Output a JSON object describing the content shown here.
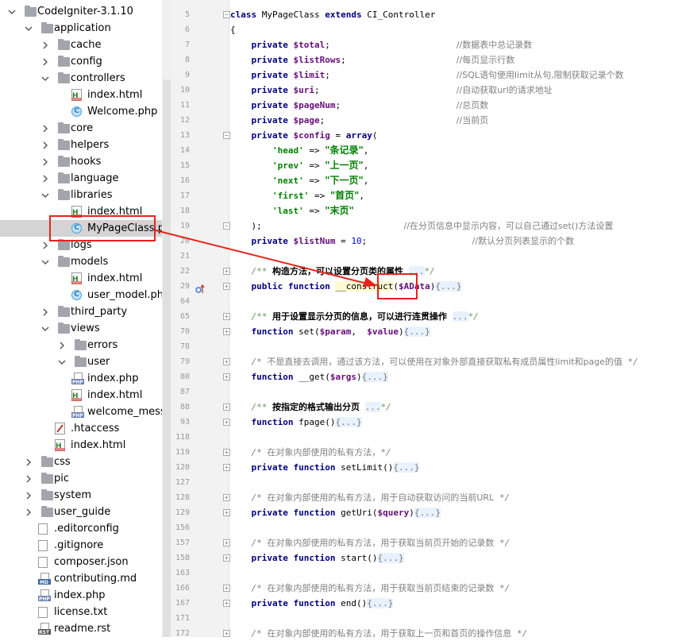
{
  "project_tree": {
    "items": [
      {
        "label": "CodeIgniter-3.1.10",
        "icon": "folder-icon",
        "depth": 0,
        "expanded": true
      },
      {
        "label": "application",
        "icon": "folder-icon",
        "depth": 1,
        "expanded": true
      },
      {
        "label": "cache",
        "icon": "folder-icon",
        "depth": 2,
        "expanded": false
      },
      {
        "label": "config",
        "icon": "folder-icon",
        "depth": 2,
        "expanded": false
      },
      {
        "label": "controllers",
        "icon": "folder-icon",
        "depth": 2,
        "expanded": true
      },
      {
        "label": "index.html",
        "icon": "html-file-icon",
        "depth": 3
      },
      {
        "label": "Welcome.php",
        "icon": "php-class-file-icon",
        "depth": 3
      },
      {
        "label": "core",
        "icon": "folder-icon",
        "depth": 2,
        "expanded": false
      },
      {
        "label": "helpers",
        "icon": "folder-icon",
        "depth": 2,
        "expanded": false
      },
      {
        "label": "hooks",
        "icon": "folder-icon",
        "depth": 2,
        "expanded": false
      },
      {
        "label": "language",
        "icon": "folder-icon",
        "depth": 2,
        "expanded": false
      },
      {
        "label": "libraries",
        "icon": "folder-icon",
        "depth": 2,
        "expanded": true
      },
      {
        "label": "index.html",
        "icon": "html-file-icon",
        "depth": 3
      },
      {
        "label": "MyPageClass.php",
        "icon": "php-class-file-icon",
        "depth": 3,
        "selected": true
      },
      {
        "label": "logs",
        "icon": "folder-icon",
        "depth": 2,
        "expanded": false
      },
      {
        "label": "models",
        "icon": "folder-icon",
        "depth": 2,
        "expanded": true
      },
      {
        "label": "index.html",
        "icon": "html-file-icon",
        "depth": 3
      },
      {
        "label": "user_model.php",
        "icon": "php-class-file-icon",
        "depth": 3
      },
      {
        "label": "third_party",
        "icon": "folder-icon",
        "depth": 2,
        "expanded": false
      },
      {
        "label": "views",
        "icon": "folder-icon",
        "depth": 2,
        "expanded": true
      },
      {
        "label": "errors",
        "icon": "folder-icon",
        "depth": 3,
        "expanded": false
      },
      {
        "label": "user",
        "icon": "folder-icon",
        "depth": 3,
        "expanded": true
      },
      {
        "label": "index.php",
        "icon": "php-file-icon",
        "depth": 4
      },
      {
        "label": "index.html",
        "icon": "html-file-icon",
        "depth": 3
      },
      {
        "label": "welcome_message.ph",
        "icon": "php-file-icon",
        "depth": 3
      },
      {
        "label": ".htaccess",
        "icon": "htaccess-file-icon",
        "depth": 2
      },
      {
        "label": "index.html",
        "icon": "html-file-icon",
        "depth": 2
      },
      {
        "label": "css",
        "icon": "folder-icon",
        "depth": 1,
        "expanded": false
      },
      {
        "label": "pic",
        "icon": "folder-icon",
        "depth": 1,
        "expanded": false
      },
      {
        "label": "system",
        "icon": "folder-icon",
        "depth": 1,
        "expanded": false
      },
      {
        "label": "user_guide",
        "icon": "folder-icon",
        "depth": 1,
        "expanded": false
      },
      {
        "label": ".editorconfig",
        "icon": "text-file-icon",
        "depth": 1
      },
      {
        "label": ".gitignore",
        "icon": "text-file-icon",
        "depth": 1
      },
      {
        "label": "composer.json",
        "icon": "text-file-icon",
        "depth": 1
      },
      {
        "label": "contributing.md",
        "icon": "md-file-icon",
        "depth": 1
      },
      {
        "label": "index.php",
        "icon": "php-file-icon",
        "depth": 1
      },
      {
        "label": "license.txt",
        "icon": "text-file-icon",
        "depth": 1
      },
      {
        "label": "readme.rst",
        "icon": "rst-file-icon",
        "depth": 1
      }
    ]
  },
  "editor": {
    "lines": [
      {
        "n": "5",
        "fold": "-",
        "tokens": [
          [
            "kw",
            "class "
          ],
          [
            "",
            "MyPageClass "
          ],
          [
            "kw",
            "extends "
          ],
          [
            "",
            "CI_Controller"
          ]
        ]
      },
      {
        "n": "6",
        "tokens": [
          [
            "",
            "{"
          ]
        ]
      },
      {
        "n": "7",
        "tokens": [
          [
            "",
            "    "
          ],
          [
            "kw",
            "private "
          ],
          [
            "var",
            "$total"
          ],
          [
            "",
            ";                        "
          ],
          [
            "cmz",
            "//数据表中总记录数"
          ]
        ]
      },
      {
        "n": "8",
        "tokens": [
          [
            "",
            "    "
          ],
          [
            "kw",
            "private "
          ],
          [
            "var",
            "$listRows"
          ],
          [
            "",
            ";                     "
          ],
          [
            "cmz",
            "//每页显示行数"
          ]
        ]
      },
      {
        "n": "9",
        "tokens": [
          [
            "",
            "    "
          ],
          [
            "kw",
            "private "
          ],
          [
            "var",
            "$limit"
          ],
          [
            "",
            ";                        "
          ],
          [
            "cmz",
            "//SQL语句使用limit从句,限制获取记录个数"
          ]
        ]
      },
      {
        "n": "10",
        "tokens": [
          [
            "",
            "    "
          ],
          [
            "kw",
            "private "
          ],
          [
            "var",
            "$uri"
          ],
          [
            "",
            ";                          "
          ],
          [
            "cmz",
            "//自动获取url的请求地址"
          ]
        ]
      },
      {
        "n": "11",
        "tokens": [
          [
            "",
            "    "
          ],
          [
            "kw",
            "private "
          ],
          [
            "var",
            "$pageNum"
          ],
          [
            "",
            ";                      "
          ],
          [
            "cmz",
            "//总页数"
          ]
        ]
      },
      {
        "n": "12",
        "tokens": [
          [
            "",
            "    "
          ],
          [
            "kw",
            "private "
          ],
          [
            "var",
            "$page"
          ],
          [
            "",
            ";                         "
          ],
          [
            "cmz",
            "//当前页"
          ]
        ]
      },
      {
        "n": "13",
        "fold": "-",
        "tokens": [
          [
            "",
            "    "
          ],
          [
            "kw",
            "private "
          ],
          [
            "var",
            "$config "
          ],
          [
            "",
            "= "
          ],
          [
            "kw",
            "array"
          ],
          [
            "",
            "("
          ]
        ]
      },
      {
        "n": "14",
        "tokens": [
          [
            "",
            "        "
          ],
          [
            "str",
            "'head'"
          ],
          [
            "",
            " => "
          ],
          [
            "cstr",
            "\"条记录\""
          ],
          [
            "",
            ","
          ]
        ]
      },
      {
        "n": "15",
        "tokens": [
          [
            "",
            "        "
          ],
          [
            "str",
            "'prev'"
          ],
          [
            "",
            " => "
          ],
          [
            "cstr",
            "\"上一页\""
          ],
          [
            "",
            ","
          ]
        ]
      },
      {
        "n": "16",
        "tokens": [
          [
            "",
            "        "
          ],
          [
            "str",
            "'next'"
          ],
          [
            "",
            " => "
          ],
          [
            "cstr",
            "\"下一页\""
          ],
          [
            "",
            ","
          ]
        ]
      },
      {
        "n": "17",
        "tokens": [
          [
            "",
            "        "
          ],
          [
            "str",
            "'first'"
          ],
          [
            "",
            " => "
          ],
          [
            "cstr",
            "\"首页\""
          ],
          [
            "",
            ","
          ]
        ]
      },
      {
        "n": "18",
        "tokens": [
          [
            "",
            "        "
          ],
          [
            "str",
            "'last'"
          ],
          [
            "",
            " => "
          ],
          [
            "cstr",
            "\"末页\""
          ]
        ]
      },
      {
        "n": "19",
        "fold": "-",
        "tokens": [
          [
            "",
            "    );                           "
          ],
          [
            "cmz",
            "//在分页信息中显示内容，可以自己通过set()方法设置"
          ]
        ]
      },
      {
        "n": "20",
        "tokens": [
          [
            "",
            "    "
          ],
          [
            "kw",
            "private "
          ],
          [
            "var",
            "$listNum "
          ],
          [
            "",
            "= "
          ],
          [
            "num",
            "10"
          ],
          [
            "",
            ";                    "
          ],
          [
            "cmz",
            "//默认分页列表显示的个数"
          ]
        ]
      },
      {
        "n": "21",
        "tokens": [
          [
            "",
            ""
          ]
        ]
      },
      {
        "n": "22",
        "fold": "+",
        "tokens": [
          [
            "",
            "    "
          ],
          [
            "doc",
            "/** "
          ],
          [
            "docz",
            "构造方法，可以设置分页类的属性"
          ],
          [
            "doc",
            " "
          ],
          [
            "dots",
            "..."
          ],
          [
            "doc",
            "*/"
          ]
        ]
      },
      {
        "n": "29",
        "fold": "+",
        "marker": true,
        "tokens": [
          [
            "",
            "    "
          ],
          [
            "kw",
            "public function "
          ],
          [
            "fn",
            "__construct"
          ],
          [
            "",
            "("
          ],
          [
            "var",
            "$AData"
          ],
          [
            "",
            ")"
          ],
          [
            "dots",
            "{...}"
          ]
        ]
      },
      {
        "n": "64",
        "tokens": [
          [
            "",
            ""
          ]
        ]
      },
      {
        "n": "65",
        "fold": "+",
        "tokens": [
          [
            "",
            "    "
          ],
          [
            "doc",
            "/** "
          ],
          [
            "docz",
            "用于设置显示分页的信息，可以进行连贯操作"
          ],
          [
            "doc",
            " "
          ],
          [
            "dots",
            "..."
          ],
          [
            "doc",
            "*/"
          ]
        ]
      },
      {
        "n": "70",
        "fold": "+",
        "tokens": [
          [
            "",
            "    "
          ],
          [
            "kw",
            "function "
          ],
          [
            "",
            "set("
          ],
          [
            "var",
            "$param"
          ],
          [
            "",
            ",  "
          ],
          [
            "var",
            "$value"
          ],
          [
            "",
            ")"
          ],
          [
            "dots",
            "{...}"
          ]
        ]
      },
      {
        "n": "78",
        "tokens": [
          [
            "",
            ""
          ]
        ]
      },
      {
        "n": "79",
        "fold": "+",
        "tokens": [
          [
            "",
            "    "
          ],
          [
            "cm",
            "/* "
          ],
          [
            "cmz",
            "不是直接去调用，通过该方法，可以使用在对象外部直接获取私有成员属性limit和page的值"
          ],
          [
            "cm",
            " */"
          ]
        ]
      },
      {
        "n": "80",
        "fold": "+",
        "tokens": [
          [
            "",
            "    "
          ],
          [
            "kw",
            "function "
          ],
          [
            "",
            "__get("
          ],
          [
            "var",
            "$args"
          ],
          [
            "",
            ")"
          ],
          [
            "dots",
            "{...}"
          ]
        ]
      },
      {
        "n": "87",
        "tokens": [
          [
            "",
            ""
          ]
        ]
      },
      {
        "n": "88",
        "fold": "+",
        "tokens": [
          [
            "",
            "    "
          ],
          [
            "doc",
            "/** "
          ],
          [
            "docz",
            "按指定的格式输出分页"
          ],
          [
            "doc",
            " "
          ],
          [
            "dots",
            "..."
          ],
          [
            "doc",
            "*/"
          ]
        ]
      },
      {
        "n": "93",
        "fold": "+",
        "tokens": [
          [
            "",
            "    "
          ],
          [
            "kw",
            "function "
          ],
          [
            "",
            "fpage()"
          ],
          [
            "dots",
            "{...}"
          ]
        ]
      },
      {
        "n": "118",
        "tokens": [
          [
            "",
            ""
          ]
        ]
      },
      {
        "n": "119",
        "fold": "+",
        "tokens": [
          [
            "",
            "    "
          ],
          [
            "cm",
            "/* "
          ],
          [
            "cmz",
            "在对象内部使用的私有方法，"
          ],
          [
            "cm",
            "*/"
          ]
        ]
      },
      {
        "n": "120",
        "fold": "+",
        "tokens": [
          [
            "",
            "    "
          ],
          [
            "kw",
            "private function "
          ],
          [
            "",
            "setLimit()"
          ],
          [
            "dots",
            "{...}"
          ]
        ]
      },
      {
        "n": "127",
        "tokens": [
          [
            "",
            ""
          ]
        ]
      },
      {
        "n": "128",
        "fold": "+",
        "tokens": [
          [
            "",
            "    "
          ],
          [
            "cm",
            "/* "
          ],
          [
            "cmz",
            "在对象内部使用的私有方法，用于自动获取访问的当前URL"
          ],
          [
            "cm",
            " */"
          ]
        ]
      },
      {
        "n": "129",
        "fold": "+",
        "tokens": [
          [
            "",
            "    "
          ],
          [
            "kw",
            "private function "
          ],
          [
            "",
            "getUri("
          ],
          [
            "var",
            "$query"
          ],
          [
            "",
            ")"
          ],
          [
            "dots",
            "{...}"
          ]
        ]
      },
      {
        "n": "156",
        "tokens": [
          [
            "",
            ""
          ]
        ]
      },
      {
        "n": "157",
        "fold": "+",
        "tokens": [
          [
            "",
            "    "
          ],
          [
            "cm",
            "/* "
          ],
          [
            "cmz",
            "在对象内部使用的私有方法，用于获取当前页开始的记录数"
          ],
          [
            "cm",
            " */"
          ]
        ]
      },
      {
        "n": "158",
        "fold": "+",
        "tokens": [
          [
            "",
            "    "
          ],
          [
            "kw",
            "private function "
          ],
          [
            "",
            "start()"
          ],
          [
            "dots",
            "{...}"
          ]
        ]
      },
      {
        "n": "163",
        "tokens": [
          [
            "",
            ""
          ]
        ]
      },
      {
        "n": "166",
        "fold": "+",
        "tokens": [
          [
            "",
            "    "
          ],
          [
            "cm",
            "/* "
          ],
          [
            "cmz",
            "在对象内部使用的私有方法，用于获取当前页结束的记录数"
          ],
          [
            "cm",
            " */"
          ]
        ]
      },
      {
        "n": "167",
        "fold": "+",
        "tokens": [
          [
            "",
            "    "
          ],
          [
            "kw",
            "private function "
          ],
          [
            "",
            "end()"
          ],
          [
            "dots",
            "{...}"
          ]
        ]
      },
      {
        "n": "171",
        "tokens": [
          [
            "",
            ""
          ]
        ]
      },
      {
        "n": "172",
        "fold": "+",
        "tokens": [
          [
            "",
            "    "
          ],
          [
            "cm",
            "/* "
          ],
          [
            "cmz",
            "在对象内部使用的私有方法，用于获取上一页和首页的操作信息"
          ],
          [
            "cm",
            " */"
          ]
        ]
      }
    ]
  },
  "annotation": {
    "color": "#e8221b",
    "highlight_file": "MyPageClass.php",
    "highlight_param": "$AData"
  }
}
